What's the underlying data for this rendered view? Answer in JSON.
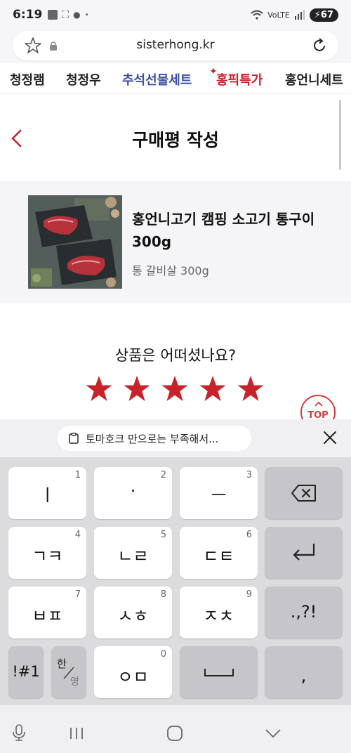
{
  "status": {
    "time": "6:19",
    "battery": "67"
  },
  "browser": {
    "url": "sisterhong.kr"
  },
  "categories": [
    {
      "label": "청정램",
      "style": "normal"
    },
    {
      "label": "청정우",
      "style": "normal"
    },
    {
      "label": "추석선물세트",
      "style": "blue"
    },
    {
      "label": "홍픽특가",
      "style": "red"
    },
    {
      "label": "홍언니세트",
      "style": "normal"
    }
  ],
  "page": {
    "title": "구매평 작성"
  },
  "product": {
    "name": "홍언니고기 캠핑 소고기 통구이 300g",
    "option": "통 갈비살 300g"
  },
  "rating": {
    "question": "상품은 어떠셨나요?",
    "stars": 5,
    "max_stars": 5
  },
  "top_button": {
    "label": "TOP"
  },
  "keyboard": {
    "suggestion": "토마호크 만으로는 부족해서...",
    "rows": [
      [
        {
          "main": "ㅣ",
          "num": "1"
        },
        {
          "main": "·",
          "num": "2"
        },
        {
          "main": "ㅡ",
          "num": "3"
        }
      ],
      [
        {
          "main": "ㄱㅋ",
          "num": "4"
        },
        {
          "main": "ㄴㄹ",
          "num": "5"
        },
        {
          "main": "ㄷㅌ",
          "num": "6"
        }
      ],
      [
        {
          "main": "ㅂㅍ",
          "num": "7"
        },
        {
          "main": "ㅅㅎ",
          "num": "8"
        },
        {
          "main": "ㅈㅊ",
          "num": "9"
        }
      ]
    ],
    "punct_key": ".,?!",
    "symbol_key": "!#1",
    "lang_key_top": "한",
    "lang_key_bottom": "영",
    "zero_key": {
      "main": "ㅇㅁ",
      "num": "0"
    },
    "comma_key": ","
  },
  "colors": {
    "brand_red": "#c8222a",
    "brand_blue": "#3b4fa8"
  }
}
